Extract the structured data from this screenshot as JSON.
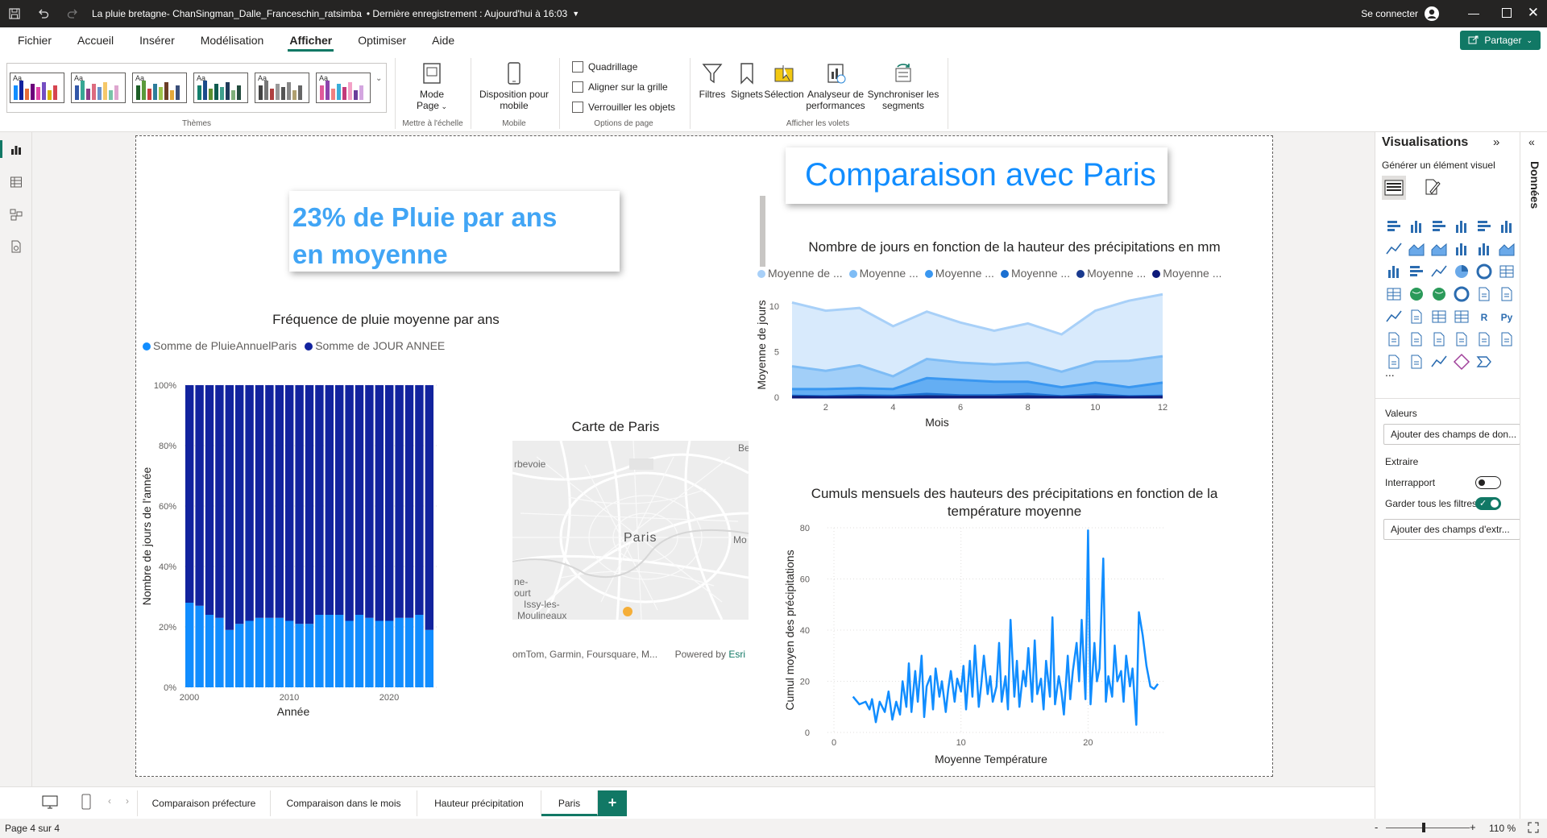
{
  "titlebar": {
    "document_title": "La pluie bretagne- ChanSingman_Dalle_Franceschin_ratsimba",
    "save_status": "• Dernière enregistrement : Aujourd'hui à 16:03",
    "sign_in": "Se connecter"
  },
  "menu": {
    "items": [
      "Fichier",
      "Accueil",
      "Insérer",
      "Modélisation",
      "Afficher",
      "Optimiser",
      "Aide"
    ],
    "active": "Afficher",
    "share": "Partager"
  },
  "ribbon": {
    "themes_label": "Thèmes",
    "page_view": {
      "label_line1": "Mode",
      "label_line2": "Page",
      "group": "Mettre à l'échelle"
    },
    "mobile": {
      "label_line1": "Disposition pour",
      "label_line2": "mobile",
      "group": "Mobile"
    },
    "options": {
      "gridlines": "Quadrillage",
      "snap": "Aligner sur la grille",
      "lock": "Verrouiller les objets",
      "group": "Options de page"
    },
    "panes": {
      "filters": "Filtres",
      "bookmarks": "Signets",
      "selection": "Sélection",
      "perf_line1": "Analyseur de",
      "perf_line2": "performances",
      "sync_line1": "Synchroniser les",
      "sync_line2": "segments",
      "group": "Afficher les volets"
    }
  },
  "report": {
    "card_text_line1": "23% de Pluie par ans",
    "card_text_line2": "en moyenne",
    "header_title": "Comparaison avec Paris",
    "map": {
      "title": "Carte de Paris",
      "labels": [
        "rbevoie",
        "Be",
        "Paris",
        "Mo",
        "ne-",
        "ourt",
        "Issy-les-",
        "Moulineaux"
      ],
      "attribution": "omTom, Garmin, Foursquare, M...",
      "powered_by": "Powered by",
      "esri": "Esri"
    }
  },
  "chart_data": [
    {
      "type": "bar",
      "stacked": "100%",
      "title": "Fréquence de pluie moyenne par ans",
      "xlabel": "Année",
      "ylabel": "Nombre de jours de l'année",
      "x": [
        1999,
        2000,
        2001,
        2002,
        2003,
        2004,
        2005,
        2006,
        2007,
        2008,
        2009,
        2010,
        2011,
        2012,
        2013,
        2014,
        2015,
        2016,
        2017,
        2018,
        2019,
        2020,
        2021,
        2022
      ],
      "x_ticks": [
        "2000",
        "2010",
        "2020"
      ],
      "y_ticks": [
        "0%",
        "20%",
        "40%",
        "60%",
        "80%",
        "100%"
      ],
      "series": [
        {
          "name": "Somme de PluieAnnuelParis",
          "color": "#118dff",
          "values": [
            28,
            27,
            24,
            23,
            19,
            21,
            22,
            23,
            23,
            23,
            22,
            21,
            21,
            24,
            24,
            24,
            22,
            24,
            23,
            22,
            22,
            23,
            23,
            24,
            19
          ]
        },
        {
          "name": "Somme de JOUR ANNEE",
          "color": "#12239e",
          "values": [
            72,
            73,
            76,
            77,
            81,
            79,
            78,
            77,
            77,
            77,
            78,
            79,
            79,
            76,
            76,
            76,
            78,
            76,
            77,
            78,
            78,
            77,
            77,
            76,
            81
          ]
        }
      ]
    },
    {
      "type": "area",
      "title": "Nombre de jours en fonction de la hauteur des précipitations en mm",
      "xlabel": "Mois",
      "ylabel": "Moyenne de jours",
      "x": [
        1,
        2,
        3,
        4,
        5,
        6,
        7,
        8,
        9,
        10,
        11,
        12
      ],
      "x_ticks": [
        "2",
        "4",
        "6",
        "8",
        "10",
        "12"
      ],
      "y_ticks": [
        "0",
        "5",
        "10"
      ],
      "legend_labels": [
        "Moyenne de ...",
        "Moyenne ...",
        "Moyenne ...",
        "Moyenne ...",
        "Moyenne ...",
        "Moyenne ..."
      ],
      "series": [
        {
          "color": "#a8d0f8",
          "values": [
            10.4,
            9.5,
            9.8,
            7.8,
            9.4,
            8.2,
            7.3,
            8.1,
            6.9,
            9.5,
            10.6,
            11.3
          ]
        },
        {
          "color": "#7ebcf5",
          "values": [
            3.4,
            2.9,
            3.5,
            2.3,
            4.2,
            3.8,
            3.6,
            3.8,
            2.8,
            3.9,
            4.0,
            4.5
          ]
        },
        {
          "color": "#3a97f0",
          "values": [
            0.9,
            0.9,
            1.0,
            0.9,
            2.1,
            1.9,
            1.7,
            1.7,
            1.1,
            1.6,
            1.1,
            1.6
          ]
        },
        {
          "color": "#1a6fd1",
          "values": [
            0.15,
            0.1,
            0.2,
            0.15,
            0.35,
            0.2,
            0.2,
            0.35,
            0.1,
            0.3,
            0.1,
            0.15
          ]
        },
        {
          "color": "#1a3a8e",
          "values": [
            0.05,
            0.0,
            0.05,
            0.0,
            0.1,
            0.05,
            0.05,
            0.1,
            0.0,
            0.1,
            0.0,
            0.05
          ]
        },
        {
          "color": "#0d1a7a",
          "values": [
            0.0,
            0.0,
            0.0,
            0.0,
            0.0,
            0.0,
            0.0,
            0.0,
            0.0,
            0.0,
            0.0,
            0.0
          ]
        }
      ],
      "ylim": [
        0,
        11.5
      ]
    },
    {
      "type": "line",
      "title_line1": "Cumuls mensuels des hauteurs des précipitations en fonction de la",
      "title_line2": "température moyenne",
      "xlabel": "Moyenne Température",
      "ylabel": "Cumul moyen des précipitations",
      "x_ticks": [
        "0",
        "10",
        "20"
      ],
      "y_ticks": [
        "0",
        "20",
        "40",
        "60",
        "80"
      ],
      "xlim": [
        0,
        26
      ],
      "ylim": [
        0,
        80
      ],
      "color": "#118dff",
      "x": [
        1.5,
        2.0,
        2.5,
        2.8,
        3.0,
        3.3,
        3.6,
        4.0,
        4.3,
        4.6,
        4.9,
        5.2,
        5.4,
        5.7,
        5.9,
        6.1,
        6.4,
        6.6,
        6.9,
        7.1,
        7.3,
        7.6,
        7.8,
        8.0,
        8.3,
        8.5,
        8.8,
        9.0,
        9.2,
        9.5,
        9.7,
        10.0,
        10.2,
        10.4,
        10.7,
        10.9,
        11.1,
        11.4,
        11.6,
        11.8,
        12.1,
        12.3,
        12.5,
        12.8,
        13.0,
        13.2,
        13.5,
        13.7,
        13.9,
        14.2,
        14.4,
        14.6,
        14.9,
        15.1,
        15.3,
        15.6,
        15.8,
        16.0,
        16.3,
        16.5,
        16.7,
        17.0,
        17.2,
        17.4,
        17.7,
        17.9,
        18.1,
        18.4,
        18.6,
        18.8,
        19.1,
        19.3,
        19.5,
        19.8,
        20.0,
        20.2,
        20.5,
        20.7,
        20.9,
        21.2,
        21.4,
        21.6,
        21.9,
        22.1,
        22.3,
        22.6,
        22.8,
        23.0,
        23.3,
        23.5,
        23.8,
        24.0,
        24.3,
        24.6,
        24.9,
        25.2,
        25.5
      ],
      "y": [
        14,
        11,
        12,
        9,
        13,
        4,
        12,
        8,
        16,
        5,
        12,
        7,
        20,
        10,
        27,
        8,
        24,
        12,
        30,
        6,
        18,
        22,
        9,
        25,
        14,
        20,
        8,
        17,
        24,
        12,
        21,
        16,
        26,
        9,
        28,
        14,
        34,
        10,
        19,
        30,
        15,
        22,
        12,
        18,
        35,
        12,
        22,
        9,
        44,
        14,
        28,
        10,
        24,
        18,
        33,
        12,
        36,
        15,
        21,
        9,
        28,
        14,
        45,
        11,
        22,
        16,
        7,
        30,
        13,
        24,
        35,
        20,
        44,
        13,
        79,
        11,
        35,
        20,
        25,
        68,
        12,
        22,
        14,
        34,
        20,
        24,
        12,
        30,
        18,
        25,
        3,
        47,
        38,
        26,
        18,
        17,
        19
      ]
    }
  ],
  "viz_pane": {
    "title": "Visualisations",
    "build_label": "Générer un élément visuel",
    "more": "...",
    "values_label": "Valeurs",
    "add_fields": "Ajouter des champs de don...",
    "drill_label": "Extraire",
    "cross_report": "Interrapport",
    "keep_filters": "Garder tous les filtres",
    "add_drill": "Ajouter des champs d'extr...",
    "data_tab": "Données"
  },
  "page_tabs": {
    "items": [
      "Comparaison préfecture",
      "Comparaison dans le mois",
      "Hauteur précipitation",
      "Paris"
    ],
    "active": "Paris",
    "add": "+"
  },
  "status": {
    "page": "Page 4 sur 4",
    "zoom": "110 %",
    "minus": "-",
    "plus": "+"
  }
}
